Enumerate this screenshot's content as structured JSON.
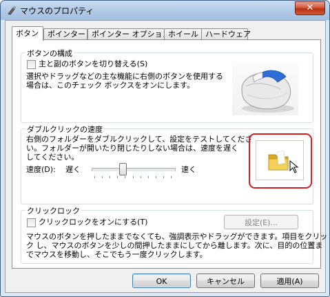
{
  "window": {
    "title": "マウスのプロパティ",
    "close_label": "✕"
  },
  "tabs": [
    {
      "label": "ボタン",
      "active": true
    },
    {
      "label": "ポインター",
      "active": false
    },
    {
      "label": "ポインター オプション",
      "active": false
    },
    {
      "label": "ホイール",
      "active": false
    },
    {
      "label": "ハードウェア",
      "active": false
    }
  ],
  "button_config": {
    "group_label": "ボタンの構成",
    "swap_checkbox_label": "主と副のボタンを切り替える(S)",
    "swap_checked": false,
    "description_line1": "選択やドラッグなどの主な機能に右側のボタンを使用する",
    "description_line2": "場合は、このチェック ボックスをオンにします。"
  },
  "double_click": {
    "group_label": "ダブルクリックの速度",
    "description_line1": "右側のフォルダーをダブルクリックして、設定をテストしてくださ",
    "description_line2": "い。フォルダーが開いたり閉じたりしない場合は、速度を遅く",
    "description_line3": "してください。",
    "speed_label": "速度(D):",
    "slow_label": "遅く",
    "fast_label": "速く",
    "speed_value": 0.36
  },
  "click_lock": {
    "group_label": "クリックロック",
    "checkbox_label": "クリックロックをオンにする(T)",
    "checked": false,
    "settings_button": "設定(E)...",
    "description_line1": "マウスのボタンを押したままでなくても、強調表示やドラッグができます。項目をクリッ",
    "description_line2": "ク し、マウスのボタンを少しの間押したままにしてから離します。次に、目的の位置ま",
    "description_line3": "でマウスを移動し、そこでもう一度クリックします。"
  },
  "footer": {
    "ok": "OK",
    "cancel": "キャンセル",
    "apply": "適用(A)"
  },
  "colors": {
    "highlight": "#d31e24",
    "folder": "#e8c24c"
  }
}
